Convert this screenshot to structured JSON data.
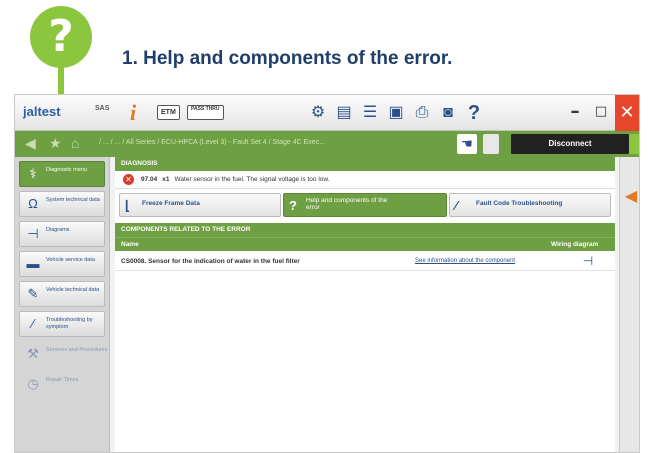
{
  "annotation": {
    "badge": "?",
    "caption": "1. Help and components of the error."
  },
  "toolbar": {
    "logo": "jaltest",
    "item_label": "SAS",
    "box1": "ETM",
    "box2": "PASS THRU",
    "help_glyph": "?"
  },
  "nav": {
    "breadcrumbs": "/ ... / ... / All Series / ECU-HPCA (Level 3) - Fault Set 4 / Stage 4C Exec...",
    "disconnect": "Disconnect"
  },
  "sidebar": {
    "items": [
      {
        "label": "Diagnostic menu",
        "icon": "stethoscope-icon"
      },
      {
        "label": "System technical data",
        "icon": "ohm-icon"
      },
      {
        "label": "Diagrams",
        "icon": "wiring-icon"
      },
      {
        "label": "Vehicle service data",
        "icon": "vehicle-icon"
      },
      {
        "label": "Vehicle technical data",
        "icon": "tools-icon"
      },
      {
        "label": "Troubleshooting by symptom",
        "icon": "troubleshoot-icon"
      },
      {
        "label": "Services and Procedures",
        "icon": "service-icon"
      },
      {
        "label": "Repair Times",
        "icon": "clock-icon"
      }
    ]
  },
  "main": {
    "section_title": "DIAGNOSIS",
    "error": {
      "code": "97.04",
      "count": "x1",
      "text": "Water sensor in the fuel. The signal voltage is too low."
    },
    "tabs": [
      {
        "label": "Freeze Frame Data",
        "icon": "freeze-frame-icon"
      },
      {
        "label": "Help and components of the error",
        "icon": "help-icon"
      },
      {
        "label": "Fault Code Troubleshooting",
        "icon": "troubleshoot-icon"
      }
    ],
    "components": {
      "title": "COMPONENTS RELATED TO THE ERROR",
      "col_name": "Name",
      "col_wiring": "Wiring diagram",
      "rows": [
        {
          "name": "CS0008. Sensor for the indication of water in the fuel filter",
          "link": "See information about the component"
        }
      ]
    }
  },
  "colors": {
    "accent_green": "#6e9f43",
    "badge_green": "#8cc63f",
    "caption_blue": "#1f3f6a",
    "error_red": "#d93b2b",
    "close_red": "#e8462a"
  }
}
